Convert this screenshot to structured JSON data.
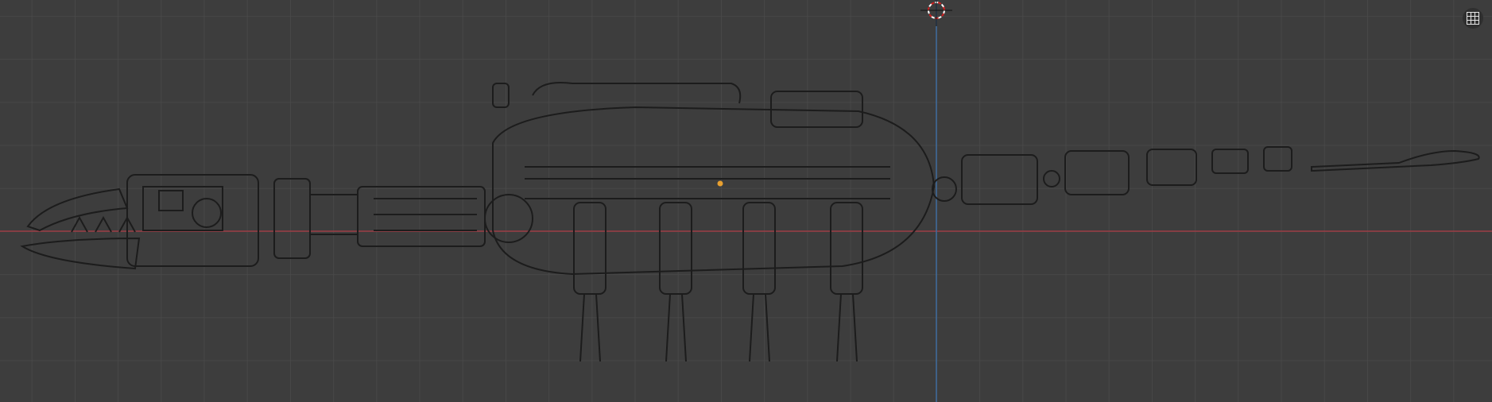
{
  "viewport": {
    "mode": "wireframe",
    "colors": {
      "background": "#3d3d3d",
      "grid": "#4a4a4a",
      "x_axis": "#9c3c44",
      "z_axis": "#3f6d9e",
      "wire": "#1c1c1c",
      "origin": "#e8a030"
    }
  },
  "overlay": {
    "grid_toggle_icon": "grid-icon"
  }
}
